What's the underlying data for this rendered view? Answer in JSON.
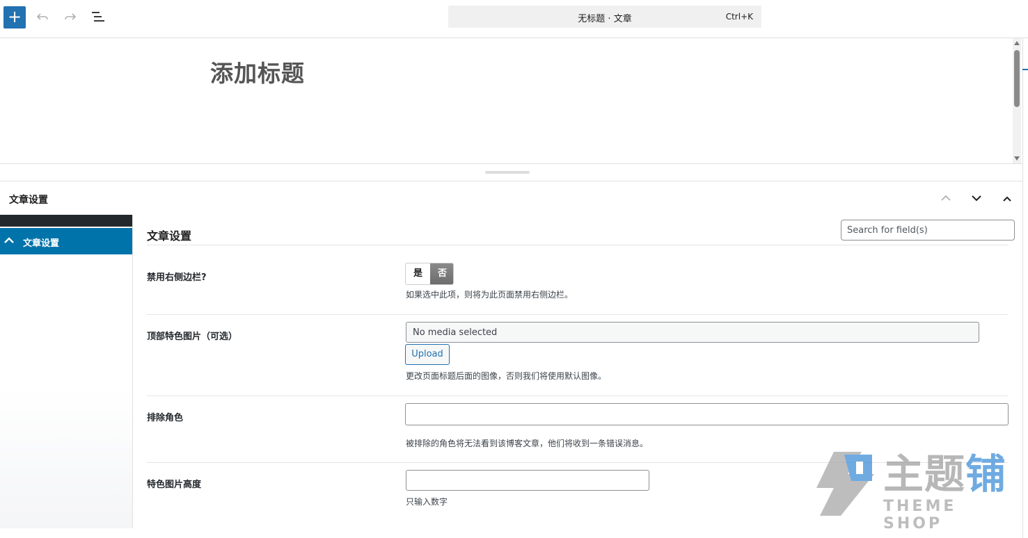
{
  "toolbar": {
    "add_label": "+",
    "command_title": "无标题 · 文章",
    "command_shortcut": "Ctrl+K"
  },
  "editor": {
    "title_placeholder": "添加标题"
  },
  "metabox": {
    "header": "文章设置",
    "nav_item": "文章设置",
    "section_title": "文章设置",
    "search_placeholder": "Search for field(s)"
  },
  "fields": {
    "disable_sidebar": {
      "label": "禁用右侧边栏?",
      "yes": "是",
      "no": "否",
      "selected": "否",
      "description": "如果选中此项，则将为此页面禁用右侧边栏。"
    },
    "featured_image": {
      "label": "顶部特色图片（可选）",
      "media_value": "No media selected",
      "upload_label": "Upload",
      "description": "更改页面标题后面的图像，否则我们将使用默认图像。"
    },
    "exclude_roles": {
      "label": "排除角色",
      "value": "",
      "description": "被排除的角色将无法看到该博客文章，他们将收到一条错误消息。"
    },
    "featured_image_height": {
      "label": "特色图片高度",
      "value": "",
      "description": "只输入数字"
    }
  },
  "watermark": {
    "main_text_gray": "主题",
    "main_text_blue": "铺",
    "sub_text": "THEME SHOP"
  },
  "colors": {
    "accent": "#2271b1",
    "nav_active": "#0073aa",
    "nav_dark": "#23282d"
  }
}
